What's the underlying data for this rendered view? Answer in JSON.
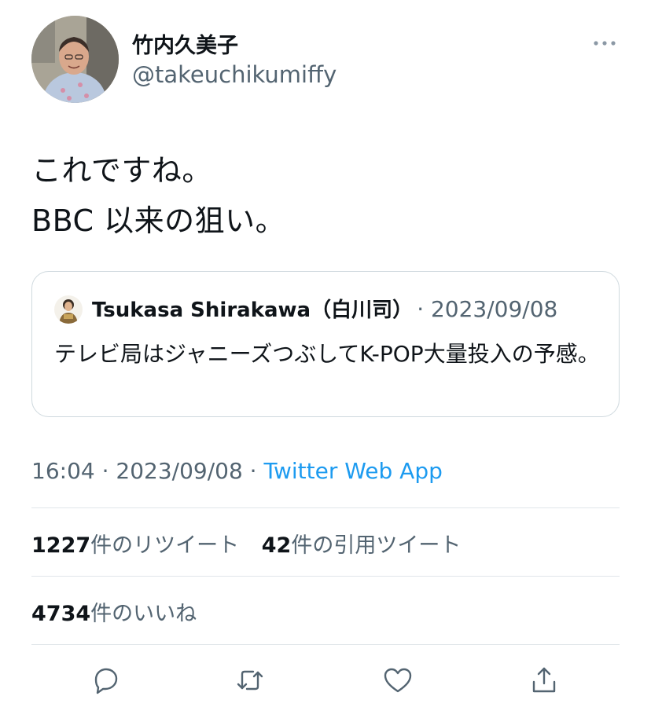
{
  "author": {
    "display_name": "竹内久美子",
    "handle": "@takeuchikumiffy"
  },
  "tweet": {
    "lines": [
      "これですね。",
      "BBC 以来の狙い。"
    ]
  },
  "quote": {
    "author_name": "Tsukasa Shirakawa（白川司）",
    "separator_date": "· 2023/09/08",
    "text": "テレビ局はジャニーズつぶしてK-POP大量投入の予感。"
  },
  "meta": {
    "time_date": "16:04 · 2023/09/08 · ",
    "source": "Twitter Web App"
  },
  "stats": {
    "retweets_count": "1227",
    "retweets_label": "件のリツイート",
    "quotes_count": "42",
    "quotes_label": "件の引用ツイート",
    "likes_count": "4734",
    "likes_label": "件のいいね"
  },
  "actions": [
    "reply-icon",
    "retweet-icon",
    "like-icon",
    "share-icon"
  ],
  "colors": {
    "link": "#1d9bf0",
    "secondary_text": "#536471",
    "primary_text": "#0f1419",
    "border": "#cfd9de"
  }
}
